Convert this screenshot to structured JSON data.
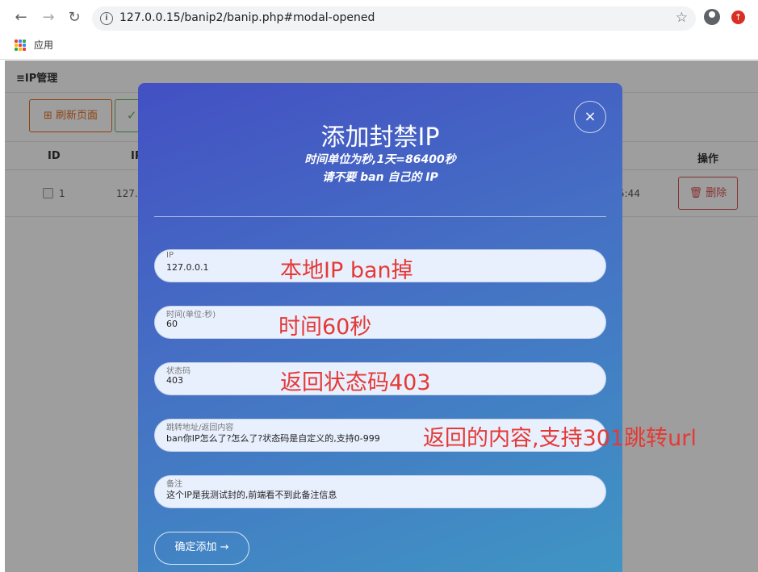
{
  "browser": {
    "url": "127.0.0.15/banip2/banip.php#modal-opened",
    "bookmarks_label": "应用",
    "back_glyph": "←",
    "forward_glyph": "→",
    "reload_glyph": "↻",
    "info_glyph": "i",
    "star_glyph": "☆",
    "update_glyph": "↑"
  },
  "page": {
    "title": "≡IP管理",
    "refresh_label": "⊞ 刷新页面",
    "green_button_glyph": "✓",
    "table": {
      "headers": {
        "id": "ID",
        "ip": "IP",
        "action": "操作"
      },
      "row": {
        "id": "1",
        "ip": "127.0",
        "time_fragment": "5:44",
        "delete_label": "🗑 删除"
      }
    }
  },
  "modal": {
    "close_glyph": "×",
    "title": "添加封禁IP",
    "subtitle1": "时间单位为秒,1天=86400秒",
    "subtitle2": "请不要 ban 自己的 IP",
    "fields": [
      {
        "label": "IP",
        "value": "127.0.0.1"
      },
      {
        "label": "时间(单位:秒)",
        "value": "60"
      },
      {
        "label": "状态码",
        "value": "403"
      },
      {
        "label": "跳转地址/返回内容",
        "value": "ban你IP怎么了?怎么了?状态码是自定义的,支持0-999"
      },
      {
        "label": "备注",
        "value": "这个IP是我测试封的,前端看不到此备注信息"
      }
    ],
    "submit_label": "确定添加 →"
  },
  "annotations": [
    "本地IP ban掉",
    "时间60秒",
    "返回状态码403",
    "返回的内容,支持301跳转url"
  ],
  "colors": {
    "modal_gradient_start": "#4350c3",
    "modal_gradient_end": "#3f95c4",
    "annotation_red": "#e53935",
    "refresh_orange": "#e56b1f",
    "delete_red": "#d9534f"
  }
}
